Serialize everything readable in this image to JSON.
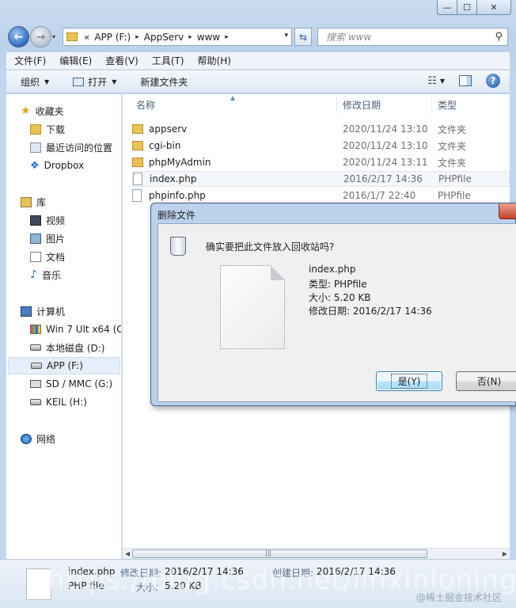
{
  "window": {
    "caption_buttons": [
      "—",
      "☐",
      "✕"
    ]
  },
  "address_bar": {
    "overflow": "«",
    "crumbs": [
      "APP (F:)",
      "AppServ",
      "www"
    ],
    "separator": "▸",
    "dropdown": "▾"
  },
  "search": {
    "placeholder": "搜索 www",
    "icon": "search-icon"
  },
  "menu": [
    "文件(F)",
    "编辑(E)",
    "查看(V)",
    "工具(T)",
    "帮助(H)"
  ],
  "commands": {
    "organize": "组织",
    "open": "打开",
    "new_folder": "新建文件夹"
  },
  "nav": {
    "favorites": "收藏夹",
    "downloads": "下载",
    "recent": "最近访问的位置",
    "dropbox": "Dropbox",
    "libraries": "库",
    "videos": "视频",
    "pictures": "图片",
    "documents": "文档",
    "music": "音乐",
    "computer": "计算机",
    "win7": "Win 7 Ult x64 (C",
    "local_d": "本地磁盘 (D:)",
    "app_f": "APP (F:)",
    "sd_g": "SD / MMC (G:)",
    "keil_h": "KEIL (H:)",
    "network": "网络"
  },
  "columns": {
    "name": "名称",
    "modified": "修改日期",
    "type": "类型"
  },
  "files": [
    {
      "name": "appserv",
      "modified": "2020/11/24 13:10",
      "type": "文件夹",
      "kind": "folder"
    },
    {
      "name": "cgi-bin",
      "modified": "2020/11/24 13:10",
      "type": "文件夹",
      "kind": "folder"
    },
    {
      "name": "phpMyAdmin",
      "modified": "2020/11/24 13:11",
      "type": "文件夹",
      "kind": "folder"
    },
    {
      "name": "index.php",
      "modified": "2016/2/17 14:36",
      "type": "PHPfile",
      "kind": "file"
    },
    {
      "name": "phpinfo.php",
      "modified": "2016/1/7 22:40",
      "type": "PHPfile",
      "kind": "file"
    }
  ],
  "dialog": {
    "title": "删除文件",
    "question": "确实要把此文件放入回收站吗?",
    "file_name": "index.php",
    "file_type": "类型: PHPfile",
    "file_size": "大小: 5.20 KB",
    "file_modified": "修改日期: 2016/2/17 14:36",
    "yes_label": "是(Y)",
    "no_label": "否(N)"
  },
  "details": {
    "name": "index.php",
    "type": "PHP file",
    "modified_label": "修改日期:",
    "modified_value": "2016/2/17 14:36",
    "created_label": "创建日期:",
    "created_value": "2016/2/17 14:36",
    "size_label": "大小:",
    "size_value": "5.20 KB"
  },
  "watermark": {
    "url": "https://blog.csdn.net/linxinloningg",
    "brand": "@稀土掘金技术社区"
  }
}
